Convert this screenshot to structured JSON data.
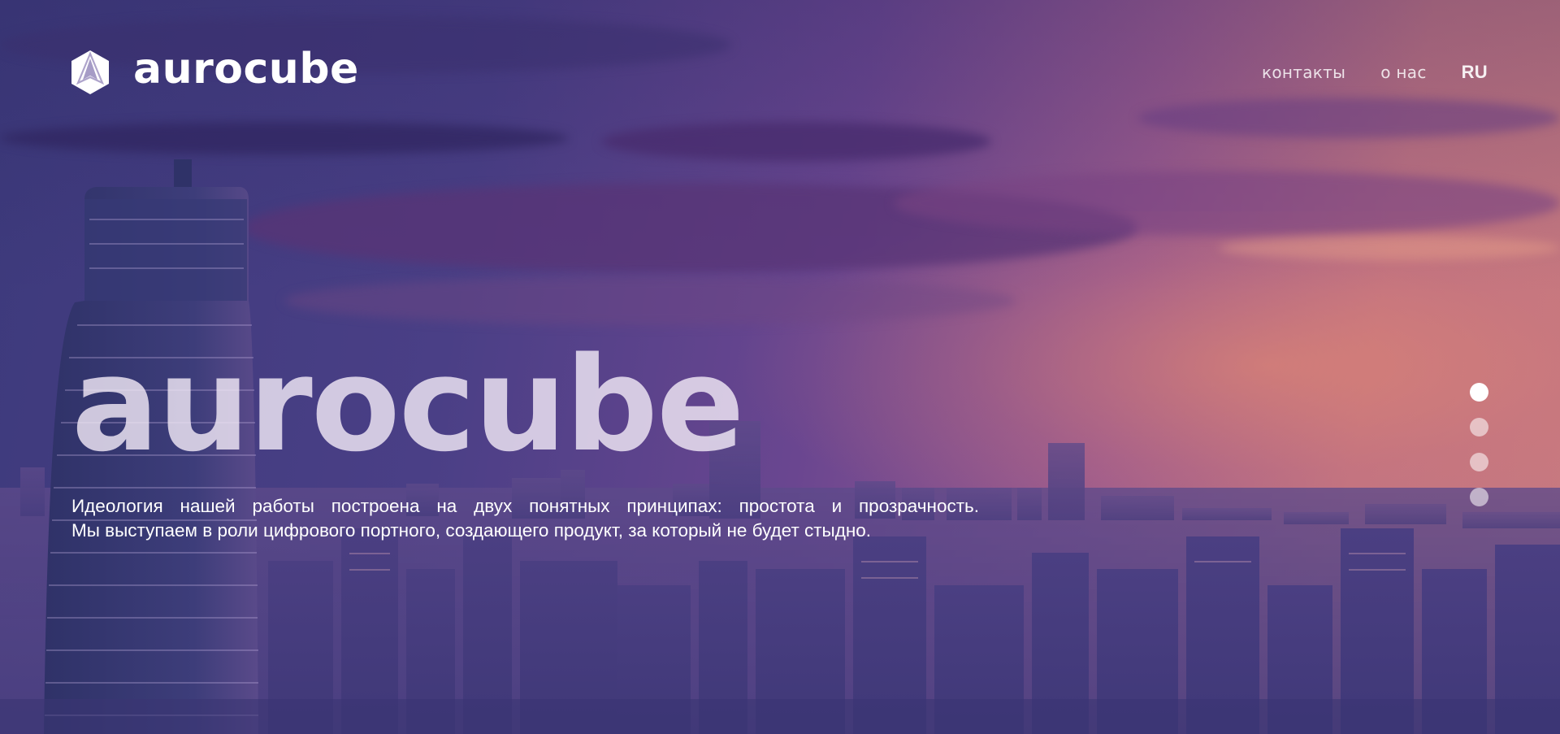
{
  "brand": {
    "logo_text": "aurocube",
    "logo_icon": "aurocube-cube-logo-icon"
  },
  "nav": {
    "contacts": "контакты",
    "about": "о нас",
    "language": "RU"
  },
  "hero": {
    "title": "aurocube",
    "lead_line_1": "Идеология нашей работы построена на двух понятных принципах: простота и прозрачность.",
    "lead_line_2": "Мы выступаем в роли цифрового портного, создающего продукт, за который не будет стыдно."
  },
  "slider": {
    "count": 4,
    "active_index": 0
  },
  "colors": {
    "sky_top": "#3d3a7c",
    "sky_horizon": "#c77a80",
    "text": "#ffffff"
  }
}
